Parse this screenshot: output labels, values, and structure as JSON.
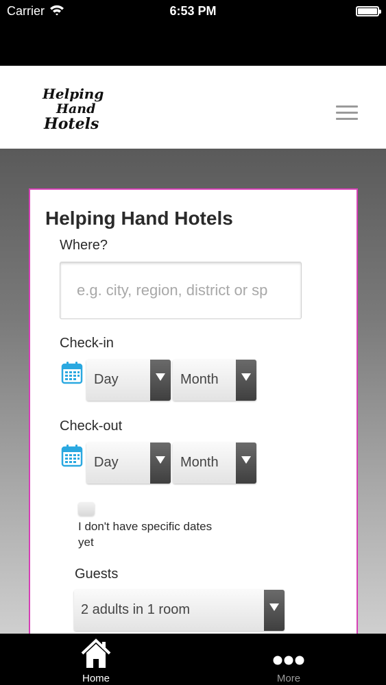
{
  "status_bar": {
    "carrier": "Carrier",
    "time": "6:53 PM"
  },
  "header": {
    "logo_line1": "Helping",
    "logo_line2": "Hand",
    "logo_line3": "Hotels",
    "menu_icon": "hamburger-menu-icon"
  },
  "form": {
    "title": "Helping Hand Hotels",
    "where_label": "Where?",
    "where_placeholder": "e.g. city, region, district or sp",
    "where_value": "",
    "checkin_label": "Check-in",
    "checkin_day": "Day",
    "checkin_month": "Month",
    "checkout_label": "Check-out",
    "checkout_day": "Day",
    "checkout_month": "Month",
    "no_dates_label": "I don't have specific dates yet",
    "no_dates_checked": false,
    "guests_label": "Guests",
    "guests_value": "2 adults in 1 room",
    "accent_color": "#d63fb6",
    "calendar_icon_color": "#2aa8e0"
  },
  "tab_bar": {
    "home_label": "Home",
    "home_icon": "home-icon",
    "more_label": "More",
    "more_icon": "more-dots-icon"
  }
}
